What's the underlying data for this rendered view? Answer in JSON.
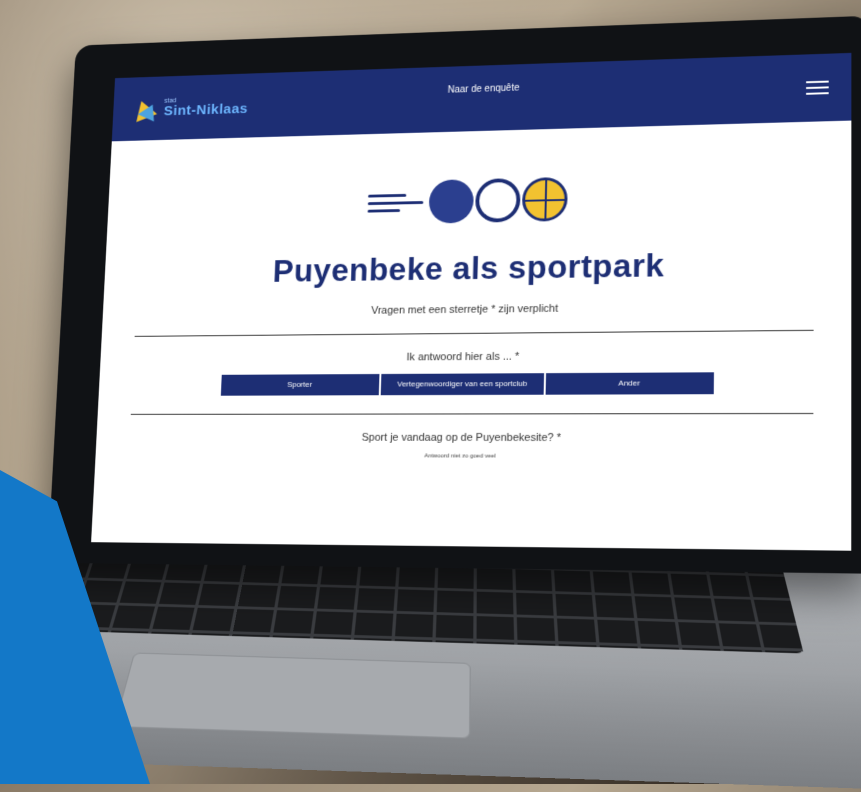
{
  "header": {
    "brand_small": "stad",
    "brand_name": "Sint-Niklaas",
    "nav_link": "Naar de enquête"
  },
  "page": {
    "title": "Puyenbeke als sportpark",
    "required_note": "Vragen met een sterretje * zijn verplicht"
  },
  "question1": {
    "label": "Ik antwoord hier als ... *",
    "options": [
      "Sporter",
      "Vertegenwoordiger van een sportclub",
      "Ander"
    ]
  },
  "question2": {
    "label": "Sport je vandaag op de Puyenbekesite? *",
    "hint": "Antwoord niet zo goed veel"
  },
  "colors": {
    "brand_navy": "#1d2e74",
    "accent_yellow": "#f2c230",
    "accent_blue": "#1378c8"
  }
}
